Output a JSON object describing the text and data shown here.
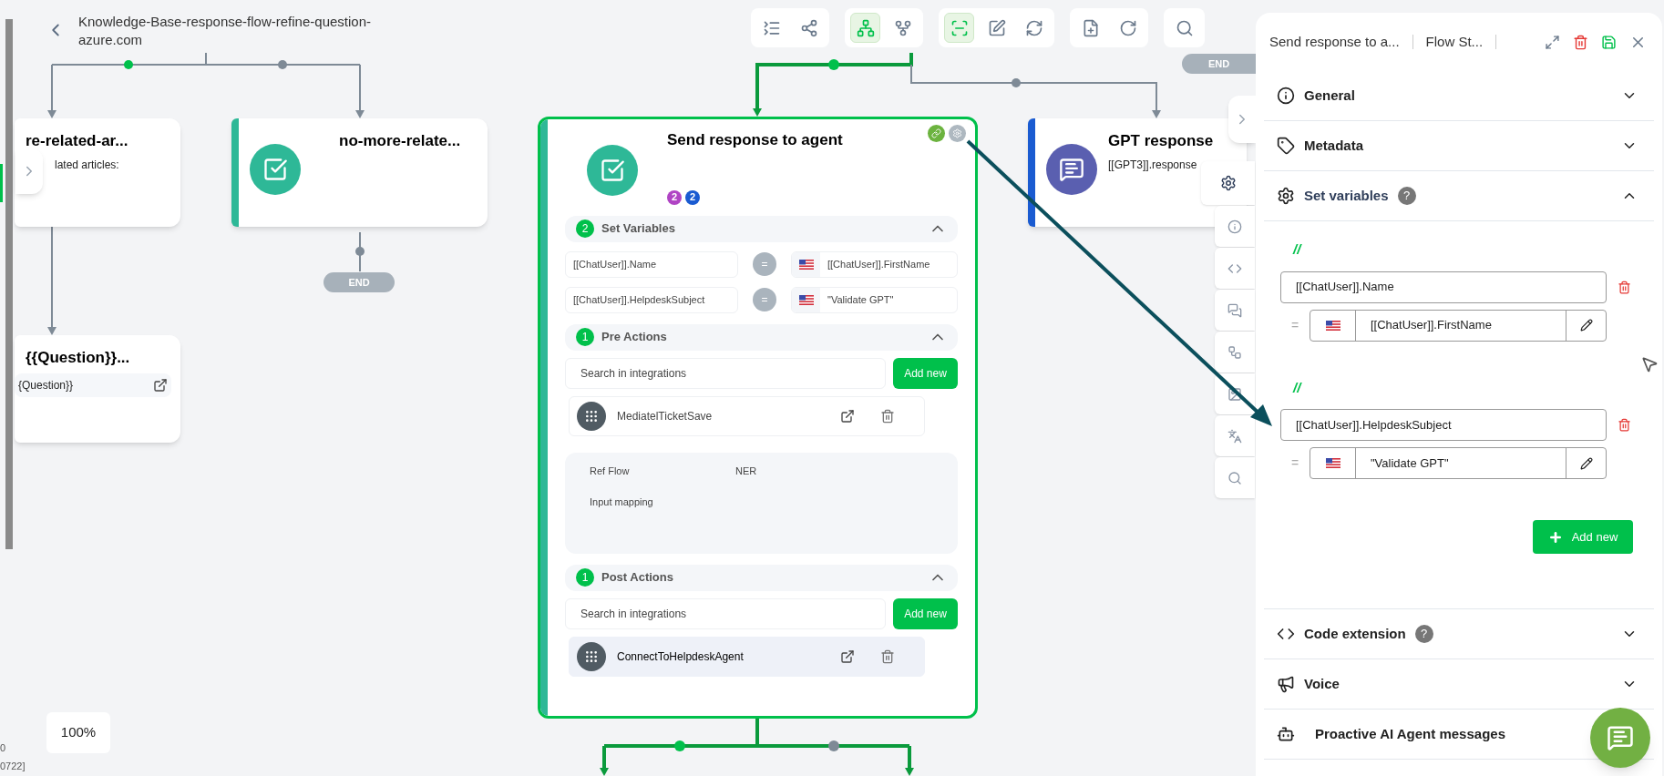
{
  "flow_title": "Knowledge-Base-response-flow-refine-question-azure.com",
  "zoom_label": "100%",
  "corner_texts": [
    "0",
    "0722]"
  ],
  "toolbar_groups": [
    {
      "items": [
        {
          "kind": "list-collapse",
          "selected": false
        },
        {
          "kind": "share",
          "selected": false
        }
      ]
    },
    {
      "items": [
        {
          "kind": "tree",
          "selected": true
        },
        {
          "kind": "fork",
          "selected": false
        }
      ]
    },
    {
      "items": [
        {
          "kind": "focus",
          "selected": true
        },
        {
          "kind": "edit",
          "selected": false
        },
        {
          "kind": "refresh",
          "selected": false
        }
      ]
    },
    {
      "items": [
        {
          "kind": "add-node",
          "selected": false
        },
        {
          "kind": "restart",
          "selected": false
        }
      ]
    },
    {
      "items": [
        {
          "kind": "search",
          "selected": false
        }
      ]
    }
  ],
  "end_markers": [
    "END",
    "END"
  ],
  "canvas_nodes": [
    {
      "title": "re-related-ar...",
      "subtitle": "lated articles:"
    },
    {
      "title": "{{Question}}...",
      "link_text": "{Question}}"
    },
    {
      "title": "no-more-relate...",
      "color": "#2eb897"
    },
    {
      "title": "GPT response",
      "subtitle": "[[GPT3]].response",
      "color": "#1a5bd1"
    }
  ],
  "main_node": {
    "title": "Send response to agent",
    "selected": true,
    "badges": [
      {
        "count": "2",
        "color": "#b044c4"
      },
      {
        "count": "2",
        "color": "#1a5bd1"
      }
    ],
    "set_variables": {
      "count": "2",
      "label": "Set Variables",
      "expanded": true,
      "rows": [
        {
          "name": "[[ChatUser]].Name",
          "operator": "=",
          "value": "[[ChatUser]].FirstName"
        },
        {
          "name": "[[ChatUser]].HelpdeskSubject",
          "operator": "=",
          "value": "\"Validate GPT\""
        }
      ]
    },
    "pre_actions": {
      "count": "1",
      "label": "Pre Actions",
      "expanded": true,
      "search_placeholder": "Search in integrations",
      "add_label": "Add new",
      "items": [
        {
          "name": "MediatelTicketSave",
          "selected": false
        }
      ]
    },
    "ref_flow": {
      "label": "Ref Flow",
      "value": "NER",
      "mapping_label": "Input mapping"
    },
    "post_actions": {
      "count": "1",
      "label": "Post Actions",
      "expanded": true,
      "search_placeholder": "Search in integrations",
      "add_label": "Add new",
      "items": [
        {
          "name": "ConnectToHelpdeskAgent",
          "selected": true
        }
      ]
    }
  },
  "side_tools": [
    {
      "kind": "settings",
      "selected": true
    },
    {
      "kind": "info",
      "selected": false
    },
    {
      "kind": "code",
      "selected": false
    },
    {
      "kind": "chat",
      "selected": false
    },
    {
      "kind": "flow",
      "selected": false
    },
    {
      "kind": "image",
      "selected": false
    },
    {
      "kind": "translate",
      "selected": false
    },
    {
      "kind": "search",
      "selected": false
    }
  ],
  "panel": {
    "title": "Send response to a...",
    "subtitle": "Flow St...",
    "sections": [
      {
        "label": "General",
        "expanded": false
      },
      {
        "label": "Metadata",
        "expanded": false
      },
      {
        "label": "Set variables",
        "help": "?",
        "expanded": true
      },
      {
        "label": "Code extension",
        "help": "?",
        "expanded": false
      },
      {
        "label": "Voice",
        "expanded": false
      },
      {
        "label": "Proactive AI Agent messages"
      }
    ],
    "variables": [
      {
        "comment": "//",
        "name": "[[ChatUser]].Name",
        "operator": "=",
        "value": "[[ChatUser]].FirstName"
      },
      {
        "comment": "//",
        "name": "[[ChatUser]].HelpdeskSubject",
        "operator": "=",
        "value": "\"Validate GPT\""
      }
    ],
    "add_label": "Add new"
  }
}
